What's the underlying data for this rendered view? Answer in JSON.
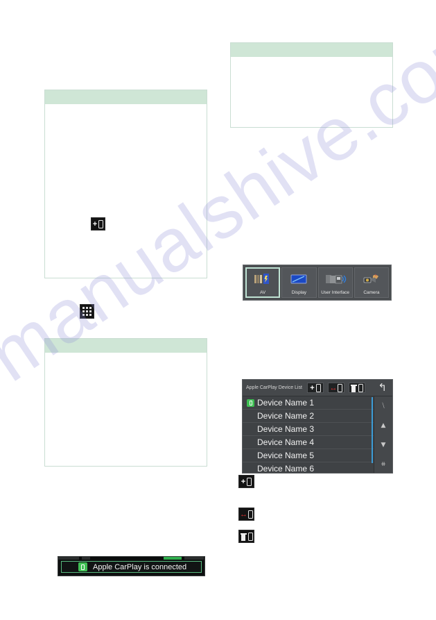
{
  "page": {
    "background": "#ffffff",
    "watermark_text": "manualshive.com",
    "watermark_color": "#8f8fd8"
  },
  "callouts": [
    {
      "id": "left-top",
      "header_color": "#cfe6d6",
      "body_text": ""
    },
    {
      "id": "left-bottom",
      "header_color": "#cfe6d6",
      "body_text": ""
    },
    {
      "id": "right-top",
      "header_color": "#cfe6d6",
      "body_text": ""
    }
  ],
  "inline_icons": [
    {
      "name": "add-device-icon",
      "glyph": "+phone"
    },
    {
      "name": "apps-grid-icon",
      "glyph": "grid-3x3"
    }
  ],
  "setup_menu": {
    "tiles": [
      {
        "label": "AV",
        "selected": true,
        "icon": "av-icon"
      },
      {
        "label": "Display",
        "selected": false,
        "icon": "display-icon"
      },
      {
        "label": "User Interface",
        "selected": false,
        "icon": "user-interface-icon"
      },
      {
        "label": "Camera",
        "selected": false,
        "icon": "camera-icon"
      }
    ],
    "selection_outline_color": "#bfe3d4"
  },
  "device_list": {
    "title": "Apple CarPlay Device List",
    "buttons": [
      {
        "name": "add-device-button",
        "glyph": "+phone"
      },
      {
        "name": "switch-device-button",
        "glyph": "swap-phone"
      },
      {
        "name": "delete-device-button",
        "glyph": "trash-phone"
      }
    ],
    "back_glyph": "↰",
    "rows": [
      {
        "name": "Device Name 1",
        "connected": true
      },
      {
        "name": "Device Name 2",
        "connected": false
      },
      {
        "name": "Device Name 3",
        "connected": false
      },
      {
        "name": "Device Name 4",
        "connected": false
      },
      {
        "name": "Device Name 5",
        "connected": false
      },
      {
        "name": "Device Name 6",
        "connected": false
      }
    ],
    "scroll_controls": [
      "⧹",
      "▲",
      "▼",
      "⧺"
    ],
    "scrollbar_color": "#3b9bd6",
    "connected_badge_color": "#3fbf53"
  },
  "legend_icons": [
    {
      "name": "add-device-icon",
      "glyph": "+phone"
    },
    {
      "name": "switch-device-icon",
      "glyph": "swap-phone"
    },
    {
      "name": "delete-device-icon",
      "glyph": "trash-phone"
    }
  ],
  "carplay_banner": {
    "message": "Apple CarPlay is connected",
    "icon": "carplay-app-icon",
    "accent_color": "#58ba7e",
    "status_segment_color": "#2fae4d"
  }
}
